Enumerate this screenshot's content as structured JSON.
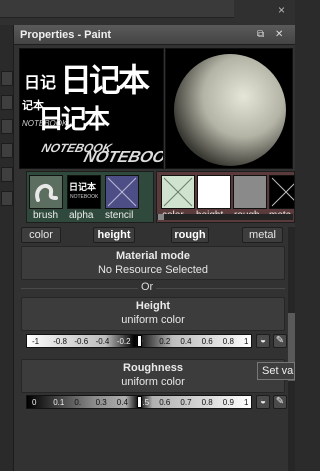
{
  "panel": {
    "title": "Properties - Paint",
    "title_buttons": [
      "⧉",
      "✕"
    ]
  },
  "preview": {
    "alpha_glyphs": [
      "日记",
      "日记本",
      "记本",
      "日记本",
      "NOTEBOOK",
      "NOTEBOOK",
      "NOTEBOOK"
    ],
    "sphere": "gray-plaster-sphere"
  },
  "brush_slots": {
    "brush_label": "brush",
    "alpha_label": "alpha",
    "alpha_text": "日记本",
    "alpha_subtext": "NOTEBOOK",
    "stencil_label": "stencil"
  },
  "material_slots": {
    "labels": [
      "color",
      "height",
      "rough",
      "meta"
    ]
  },
  "tabs": [
    {
      "label": "color",
      "active": false
    },
    {
      "label": "height",
      "active": true
    },
    {
      "label": "rough",
      "active": true
    },
    {
      "label": "metal",
      "active": false
    }
  ],
  "material_mode": {
    "heading": "Material mode",
    "value": "No Resource Selected"
  },
  "or_label": "Or",
  "height": {
    "heading": "Height",
    "value": "uniform color",
    "ticks": [
      "-1",
      "-0.8",
      "-0.6",
      "-0.4",
      "-0.2",
      "0",
      "0.2",
      "0.4",
      "0.6",
      "0.8",
      "1"
    ],
    "current": 0
  },
  "roughness": {
    "heading": "Roughness",
    "value": "uniform color",
    "ticks": [
      "0",
      "0.1",
      "0.",
      "0.3",
      "0.4",
      "0.5",
      "0.6",
      "0.7",
      "0.8",
      "0.9",
      "1"
    ],
    "current": 0.5
  },
  "tooltip": "Set va",
  "icons": {
    "picker": "color-picker-icon",
    "edit": "pencil-icon"
  }
}
